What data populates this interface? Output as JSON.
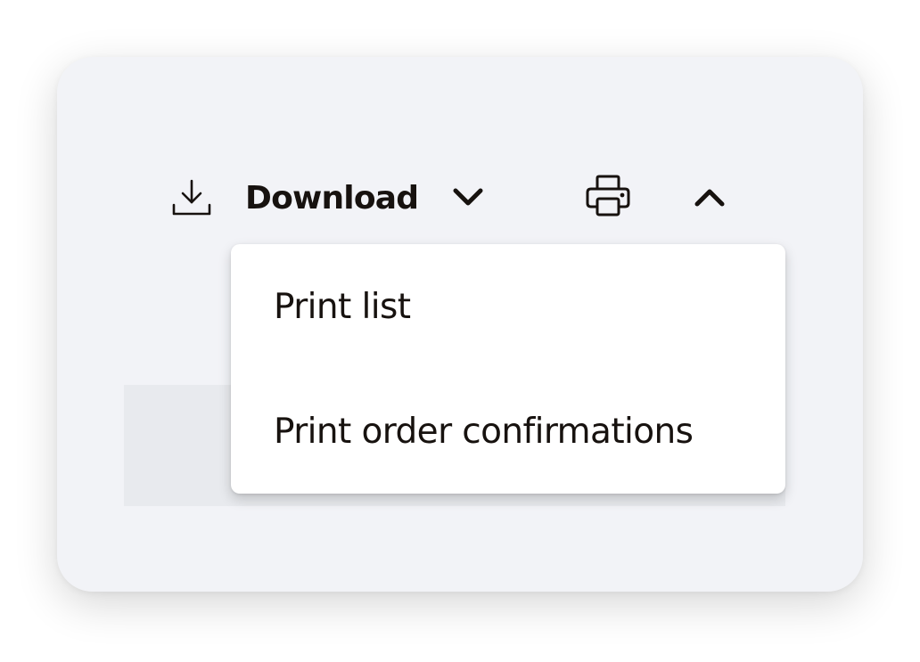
{
  "toolbar": {
    "download_label": "Download",
    "download_icon": "download-icon",
    "download_chevron_icon": "chevron-down-icon",
    "print_icon": "printer-icon",
    "collapse_icon": "chevron-up-icon"
  },
  "print_menu": {
    "items": [
      {
        "label": "Print list"
      },
      {
        "label": "Print order confirmations"
      }
    ]
  },
  "colors": {
    "card_background": "#f2f3f7",
    "panel_background": "#e8eaee",
    "text": "#17120f",
    "menu_background": "#ffffff"
  }
}
